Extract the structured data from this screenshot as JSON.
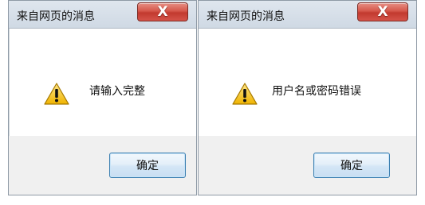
{
  "dialogs": [
    {
      "title": "来自网页的消息",
      "close_label": "X",
      "icon": "warning-icon",
      "message": "请输入完整",
      "ok_label": "确定"
    },
    {
      "title": "来自网页的消息",
      "close_label": "X",
      "icon": "warning-icon",
      "message": "用户名或密码错误",
      "ok_label": "确定"
    }
  ],
  "colors": {
    "close_button": "#d5574b",
    "warning_fill": "#f6cc2d",
    "ok_border": "#3c7fb1"
  }
}
